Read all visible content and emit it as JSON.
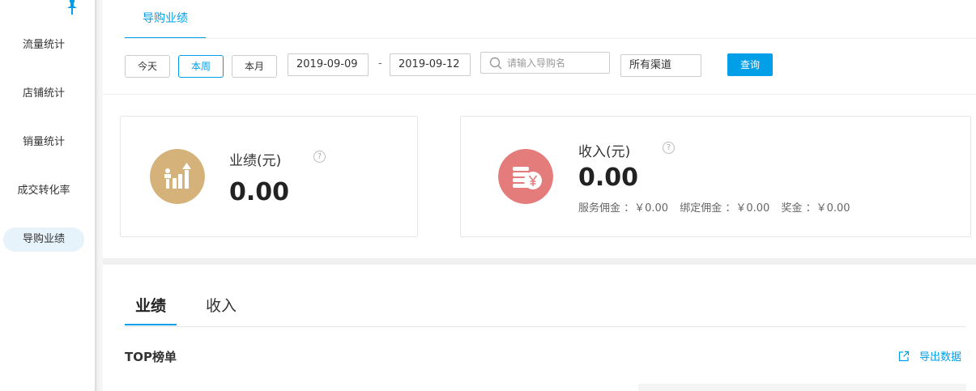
{
  "sidebar": {
    "items": [
      {
        "label": "流量统计",
        "active": false
      },
      {
        "label": "店铺统计",
        "active": false
      },
      {
        "label": "销量统计",
        "active": false
      },
      {
        "label": "成交转化率",
        "active": false
      },
      {
        "label": "导购业绩",
        "active": true
      }
    ],
    "pin_icon": "pin-icon"
  },
  "top_tab": {
    "label": "导购业绩"
  },
  "filters": {
    "today_label": "今天",
    "week_label": "本周",
    "month_label": "本月",
    "active_range": "本周",
    "start_date": "2019-09-09",
    "separator": "-",
    "end_date": "2019-09-12",
    "search_placeholder": "请输入导购名",
    "channel_value": "所有渠道",
    "query_label": "查询"
  },
  "cards": {
    "performance": {
      "title": "业绩(元)",
      "help": "?",
      "value": "0.00",
      "icon": "performance-chart-icon",
      "icon_color": "#d4b27a"
    },
    "income": {
      "title": "收入(元)",
      "help": "?",
      "value": "0.00",
      "icon": "coins-yen-icon",
      "icon_color": "#e57c7c",
      "details": [
        "服务佣金 ：￥0.00",
        "绑定佣金 ：￥0.00",
        "奖金 ：￥0.00"
      ]
    }
  },
  "sub_tabs": [
    {
      "label": "业绩",
      "active": true
    },
    {
      "label": "收入",
      "active": false
    }
  ],
  "ranking": {
    "title": "TOP榜单",
    "export_label": "导出数据"
  },
  "colors": {
    "accent": "#009fe8",
    "active_nav_bg": "#e6f3fb"
  }
}
